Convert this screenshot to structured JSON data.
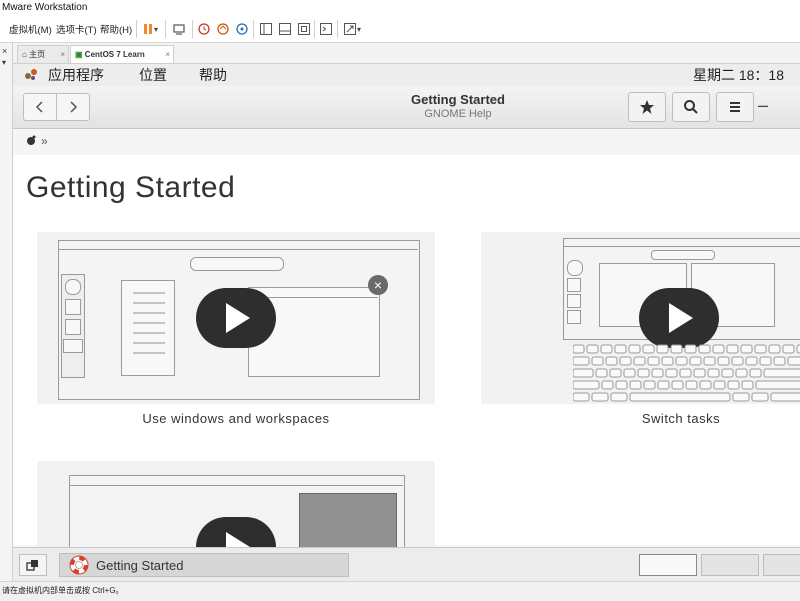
{
  "window": {
    "title": "Mware Workstation"
  },
  "vmware_menu": {
    "items": [
      "虚拟机(M)",
      "选项卡(T)",
      "帮助(H)"
    ]
  },
  "vmware_tabs": [
    {
      "label": "主页"
    },
    {
      "label": "CentOS 7 Learn"
    }
  ],
  "gnome_topbar": {
    "applications": "应用程序",
    "places": "位置",
    "help": "帮助",
    "clock": "星期二 18：18"
  },
  "help_window": {
    "title": "Getting Started",
    "subtitle": "GNOME Help",
    "breadcrumb_separator": "»",
    "page_title": "Getting Started",
    "videos": [
      {
        "caption": "Use windows and workspaces"
      },
      {
        "caption": "Switch tasks"
      },
      {
        "caption": ""
      }
    ]
  },
  "bottom_panel": {
    "task_label": "Getting Started"
  },
  "statusbar": {
    "text": "请在虚拟机内部单击或按 Ctrl+G。"
  },
  "colors": {
    "accent_pause": "#f08a24",
    "play_button": "#2e2e2e",
    "task_icon_red": "#d94032"
  }
}
